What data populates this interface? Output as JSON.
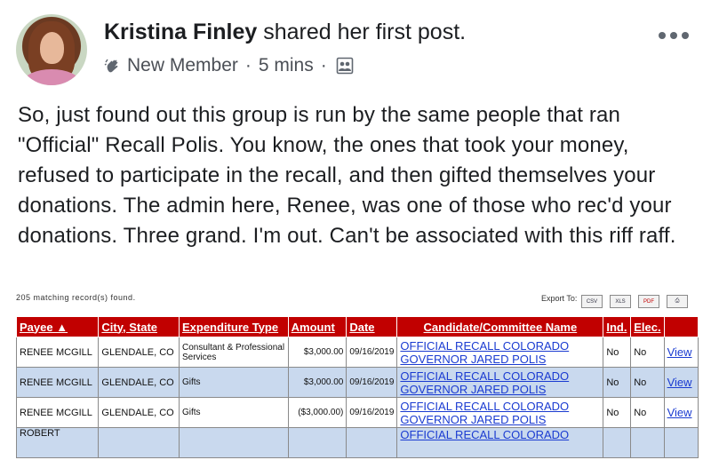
{
  "post": {
    "author": "Kristina Finley",
    "action": "shared her first post.",
    "badge_icon": "waving-hand-icon",
    "badge": "New Member",
    "separator": "·",
    "time": "5 mins",
    "privacy_icon": "group-members-icon",
    "more_icon": "more-options-icon",
    "text": "So, just found out this group is run by the same people that ran \"Official\" Recall Polis. You know, the ones that took your money, refused to participate in the recall, and then gifted themselves your donations. The admin here, Renee, was one of those who rec'd your donations. Three grand. I'm out. Can't be associated with this riff raff."
  },
  "embed": {
    "records_found": "205 matching record(s) found.",
    "export_label": "Export To:",
    "export_icons": [
      "csv-icon",
      "excel-icon",
      "pdf-icon",
      "print-icon"
    ],
    "header_color": "#c10000",
    "row_alt_color": "#c9d9ee",
    "columns": [
      "Payee ▲",
      "City, State",
      "Expenditure Type",
      "Amount",
      "Date",
      "Candidate/Committee Name",
      "Ind.",
      "Elec.",
      ""
    ],
    "rows": [
      {
        "payee": "RENEE MCGILL",
        "city": "GLENDALE, CO",
        "type": "Consultant & Professional Services",
        "amount": "$3,000.00",
        "date": "09/16/2019",
        "candidate": "OFFICIAL RECALL COLORADO GOVERNOR JARED POLIS",
        "ind": "No",
        "elec": "No",
        "view": "View"
      },
      {
        "payee": "RENEE MCGILL",
        "city": "GLENDALE, CO",
        "type": "Gifts",
        "amount": "$3,000.00",
        "date": "09/16/2019",
        "candidate": "OFFICIAL RECALL COLORADO GOVERNOR JARED POLIS",
        "ind": "No",
        "elec": "No",
        "view": "View"
      },
      {
        "payee": "RENEE MCGILL",
        "city": "GLENDALE, CO",
        "type": "Gifts",
        "amount": "($3,000.00)",
        "date": "09/16/2019",
        "candidate": "OFFICIAL RECALL COLORADO GOVERNOR JARED POLIS",
        "ind": "No",
        "elec": "No",
        "view": "View"
      },
      {
        "payee": "ROBERT",
        "city": "",
        "type": "",
        "amount": "",
        "date": "",
        "candidate": "OFFICIAL RECALL COLORADO",
        "ind": "",
        "elec": "",
        "view": ""
      }
    ]
  }
}
